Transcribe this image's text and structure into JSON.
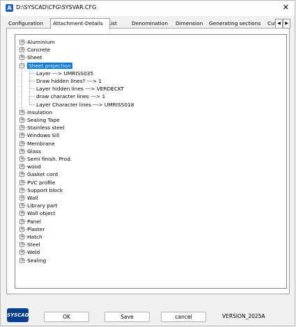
{
  "window": {
    "title": "D:\\SYSCAD\\CFG\\SYSVAR.CFG",
    "app_icon_letter": "A"
  },
  "tabs": [
    {
      "label": "Configuration"
    },
    {
      "label": "Attachment-Details",
      "active": true
    },
    {
      "label": "List"
    },
    {
      "label": "Denomination"
    },
    {
      "label": "Dimension"
    },
    {
      "label": "Generating sections"
    },
    {
      "label": "Cut"
    }
  ],
  "tab_scroll": {
    "left": "◀",
    "right": "▶"
  },
  "tree": {
    "top_items": [
      "Aluminium",
      "Concrete",
      "Sheet"
    ],
    "selected_item": "Sheet projection",
    "children": [
      "Layer  --->  UMRISS035",
      "Draw hidden lines?  --->  1",
      "Layer hidden lines  --->  VERDECKT",
      "draw character lines  --->  1",
      "Layer Character lines  --->  UMRISS018"
    ],
    "bottom_items": [
      "Insulation",
      "Sealing Tape",
      "Stainless steel",
      "Windows Sill",
      "Membrane",
      "Glass",
      "Semi finish. Prod.",
      "wood",
      "Gasket cord",
      "PVC profile",
      "Support block",
      "Wall",
      "Library part",
      "Wall object",
      "Panel",
      "Plaster",
      "Hatch",
      "Steel",
      "Weld",
      "Sealing"
    ],
    "expand_glyph": "+",
    "collapse_glyph": "−"
  },
  "footer": {
    "logo_text": "SYSCAD",
    "ok_label": "OK",
    "save_label": "Save",
    "cancel_label": "cancel",
    "version": "VERSION_2025A"
  },
  "colors": {
    "selection": "#0078d7",
    "logo": "#0a3f8c"
  }
}
